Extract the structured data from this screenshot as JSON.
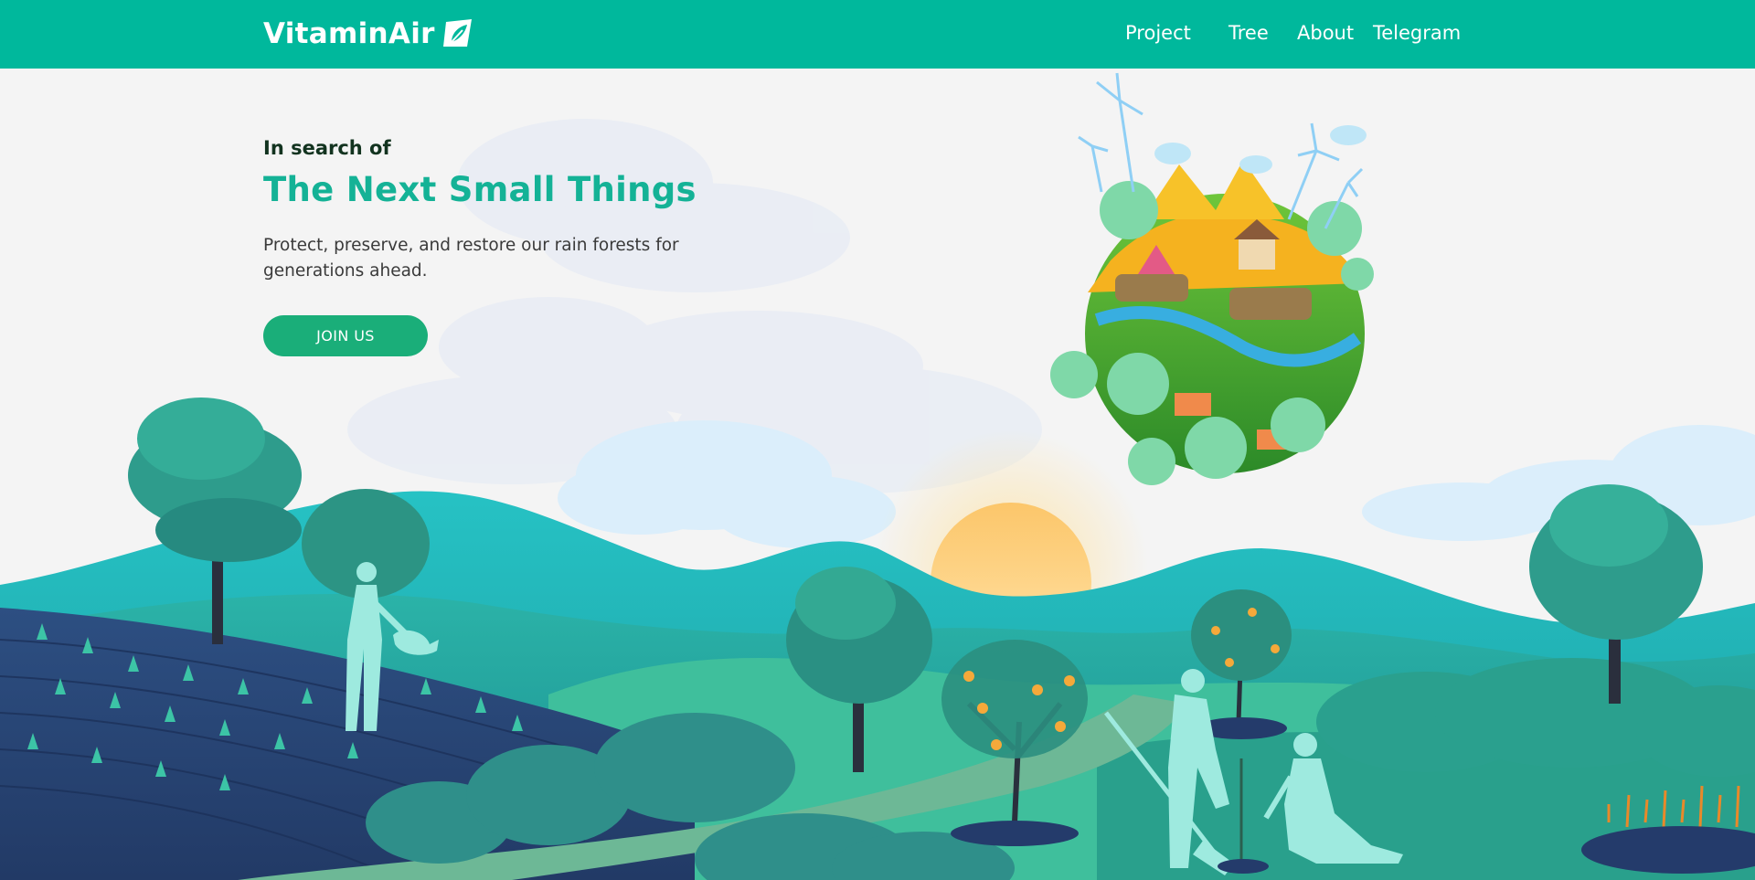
{
  "brand": {
    "name": "VitaminAir",
    "icon": "leaf-tag-icon"
  },
  "nav": {
    "items": [
      {
        "label": "Project"
      },
      {
        "label": "Tree"
      },
      {
        "label": "About"
      },
      {
        "label": "Telegram"
      }
    ]
  },
  "hero": {
    "eyebrow": "In search of",
    "title": "The Next Small Things",
    "subtitle": "Protect, preserve, and restore our rain forests for generations ahead.",
    "cta_label": "JOIN US"
  },
  "colors": {
    "accent": "#00b89c",
    "button": "#1aae79",
    "title": "#14b296",
    "eyebrow": "#12331f"
  }
}
